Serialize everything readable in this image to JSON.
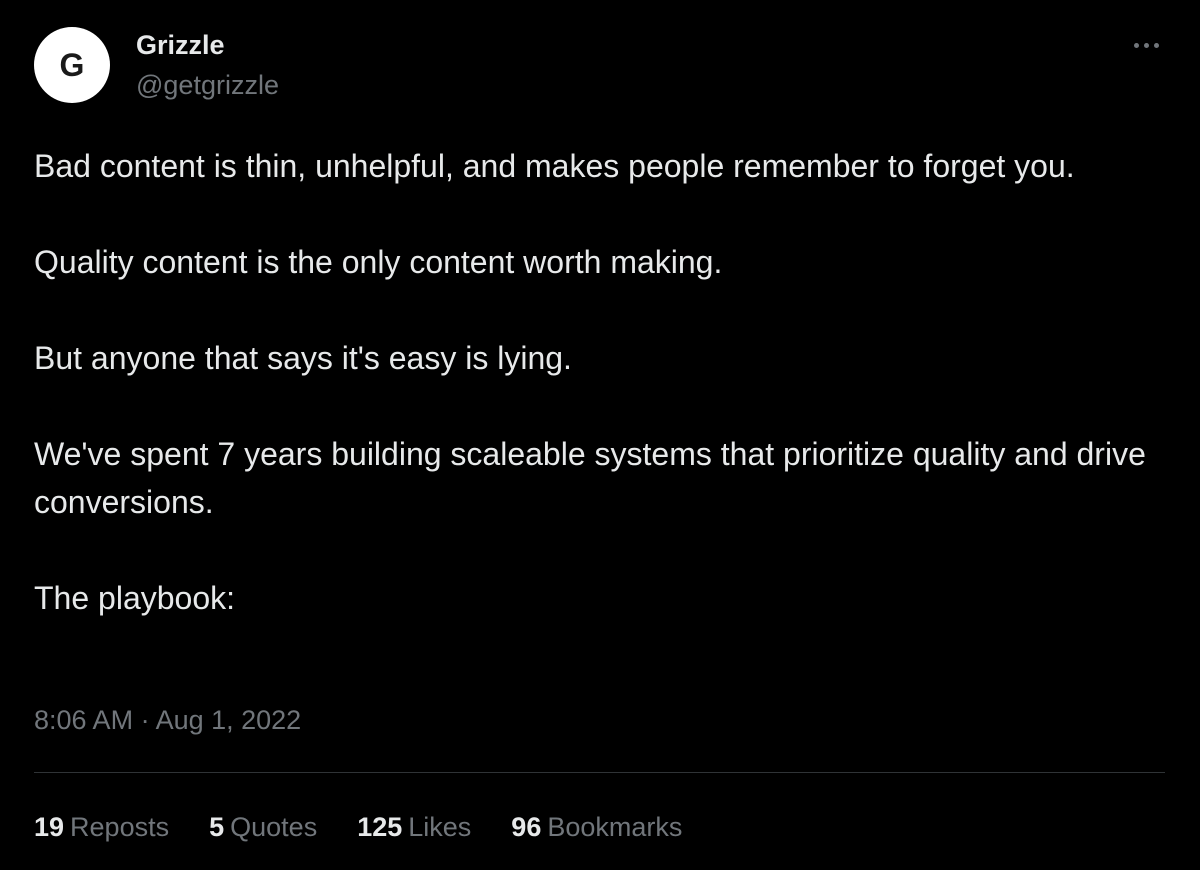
{
  "author": {
    "avatar_letter": "G",
    "name": "Grizzle",
    "handle": "@getgrizzle"
  },
  "tweet": {
    "paragraphs": [
      "Bad content is thin, unhelpful, and makes people remember to forget you.",
      "Quality content is the only content worth making.",
      "But anyone that says it's easy is lying.",
      "We've spent 7 years building scaleable systems that prioritize quality and drive conversions.",
      "The playbook:"
    ],
    "timestamp": "8:06 AM · Aug 1, 2022"
  },
  "stats": [
    {
      "count": "19",
      "label": "Reposts"
    },
    {
      "count": "5",
      "label": "Quotes"
    },
    {
      "count": "125",
      "label": "Likes"
    },
    {
      "count": "96",
      "label": "Bookmarks"
    }
  ],
  "icons": {
    "more": "more-horizontal-icon"
  },
  "colors": {
    "background": "#000000",
    "text_primary": "#e7e9ea",
    "text_secondary": "#71767b",
    "divider": "#2f3336",
    "avatar_bg": "#ffffff"
  }
}
